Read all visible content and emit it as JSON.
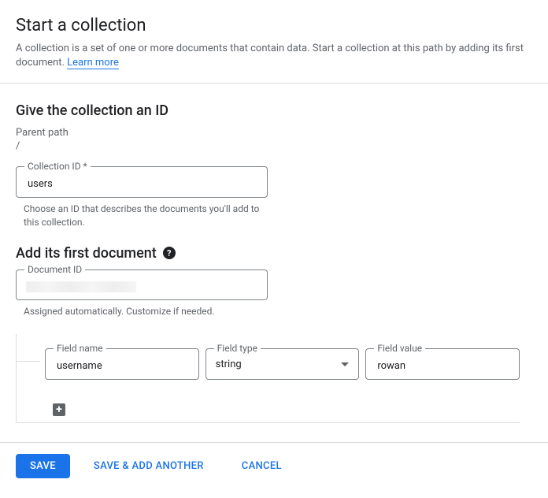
{
  "header": {
    "title": "Start a collection",
    "description": "A collection is a set of one or more documents that contain data. Start a collection at this path by adding its first document. ",
    "learn_more": "Learn more"
  },
  "collection": {
    "heading": "Give the collection an ID",
    "parent_path_label": "Parent path",
    "parent_path_value": "/",
    "id_label": "Collection ID *",
    "id_value": "users",
    "id_helper": "Choose an ID that describes the documents you'll add to this collection."
  },
  "document": {
    "heading": "Add its first document",
    "id_label": "Document ID",
    "id_helper": "Assigned automatically. Customize if needed.",
    "field_name_label": "Field name",
    "field_name_value": "username",
    "field_type_label": "Field type",
    "field_type_value": "string",
    "field_value_label": "Field value",
    "field_value_value": "rowan"
  },
  "footer": {
    "save": "SAVE",
    "save_another": "SAVE & ADD ANOTHER",
    "cancel": "CANCEL"
  }
}
